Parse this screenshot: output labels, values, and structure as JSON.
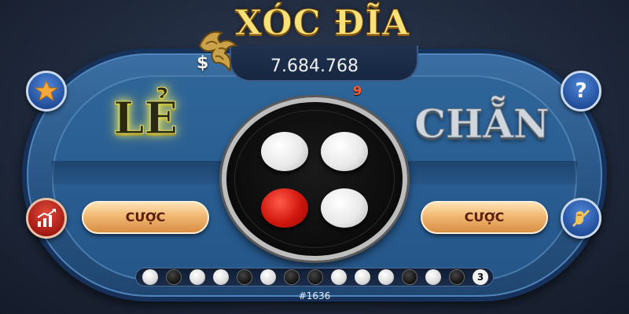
{
  "game": {
    "title": "XÓC ĐĨA",
    "currency_symbol": "$",
    "balance": "7.684.768",
    "timer": "9",
    "round_id": "#1636"
  },
  "bets": {
    "le_label": "LẺ",
    "chan_label": "CHẴN",
    "le_button": "CƯỢC",
    "chan_button": "CƯỢC"
  },
  "buttons": {
    "help_label": "?",
    "star_icon": "star-icon",
    "chart_icon": "chart-icon",
    "mute_icon": "mute-icon"
  },
  "coins": [
    "white",
    "white",
    "red",
    "white"
  ],
  "history": {
    "results": [
      "white",
      "black",
      "white",
      "white",
      "black",
      "white",
      "black",
      "black",
      "white",
      "white",
      "white",
      "black",
      "white",
      "black"
    ],
    "count": "3"
  },
  "colors": {
    "table": "#2a5788",
    "le_glow": "#f5f06a",
    "bet_button": "#f1b873",
    "coin_red": "#d0160c",
    "timer": "#ff5a2a"
  }
}
